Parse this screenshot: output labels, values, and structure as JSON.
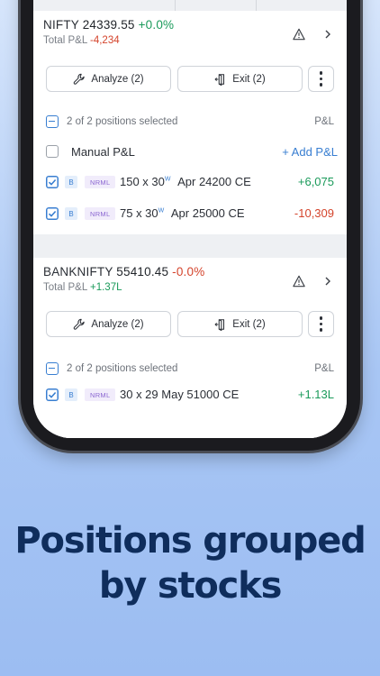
{
  "groups": [
    {
      "symbol": "NIFTY",
      "price": "24339.55",
      "change": "+0.0%",
      "total_pl_label": "Total P&L",
      "total_pl": "-4,234",
      "analyze_label": "Analyze (2)",
      "exit_label": "Exit (2)",
      "selected_text": "2 of 2 positions selected",
      "pl_header": "P&L",
      "manual_label": "Manual P&L",
      "add_pl_label": "+ Add P&L",
      "positions": [
        {
          "side": "B",
          "product": "NRML",
          "qty": "150 x 30",
          "sup": "W",
          "contract": "Apr 24200 CE",
          "pl": "+6,075"
        },
        {
          "side": "B",
          "product": "NRML",
          "qty": "75 x 30",
          "sup": "W",
          "contract": "Apr 25000 CE",
          "pl": "-10,309"
        }
      ]
    },
    {
      "symbol": "BANKNIFTY",
      "price": "55410.45",
      "change": "-0.0%",
      "total_pl_label": "Total P&L",
      "total_pl": "+1.37L",
      "analyze_label": "Analyze (2)",
      "exit_label": "Exit (2)",
      "selected_text": "2 of 2 positions selected",
      "pl_header": "P&L",
      "positions": [
        {
          "side": "B",
          "product": "NRML",
          "qty": "30 x 29 May 51000 CE",
          "pl": "+1.13L"
        }
      ]
    }
  ],
  "caption": {
    "line1": "Positions grouped",
    "line2": "by stocks"
  },
  "colors": {
    "accent": "#387ed1",
    "profit": "#1a9a5a",
    "loss": "#d4442c",
    "caption": "#0f2d5c"
  }
}
